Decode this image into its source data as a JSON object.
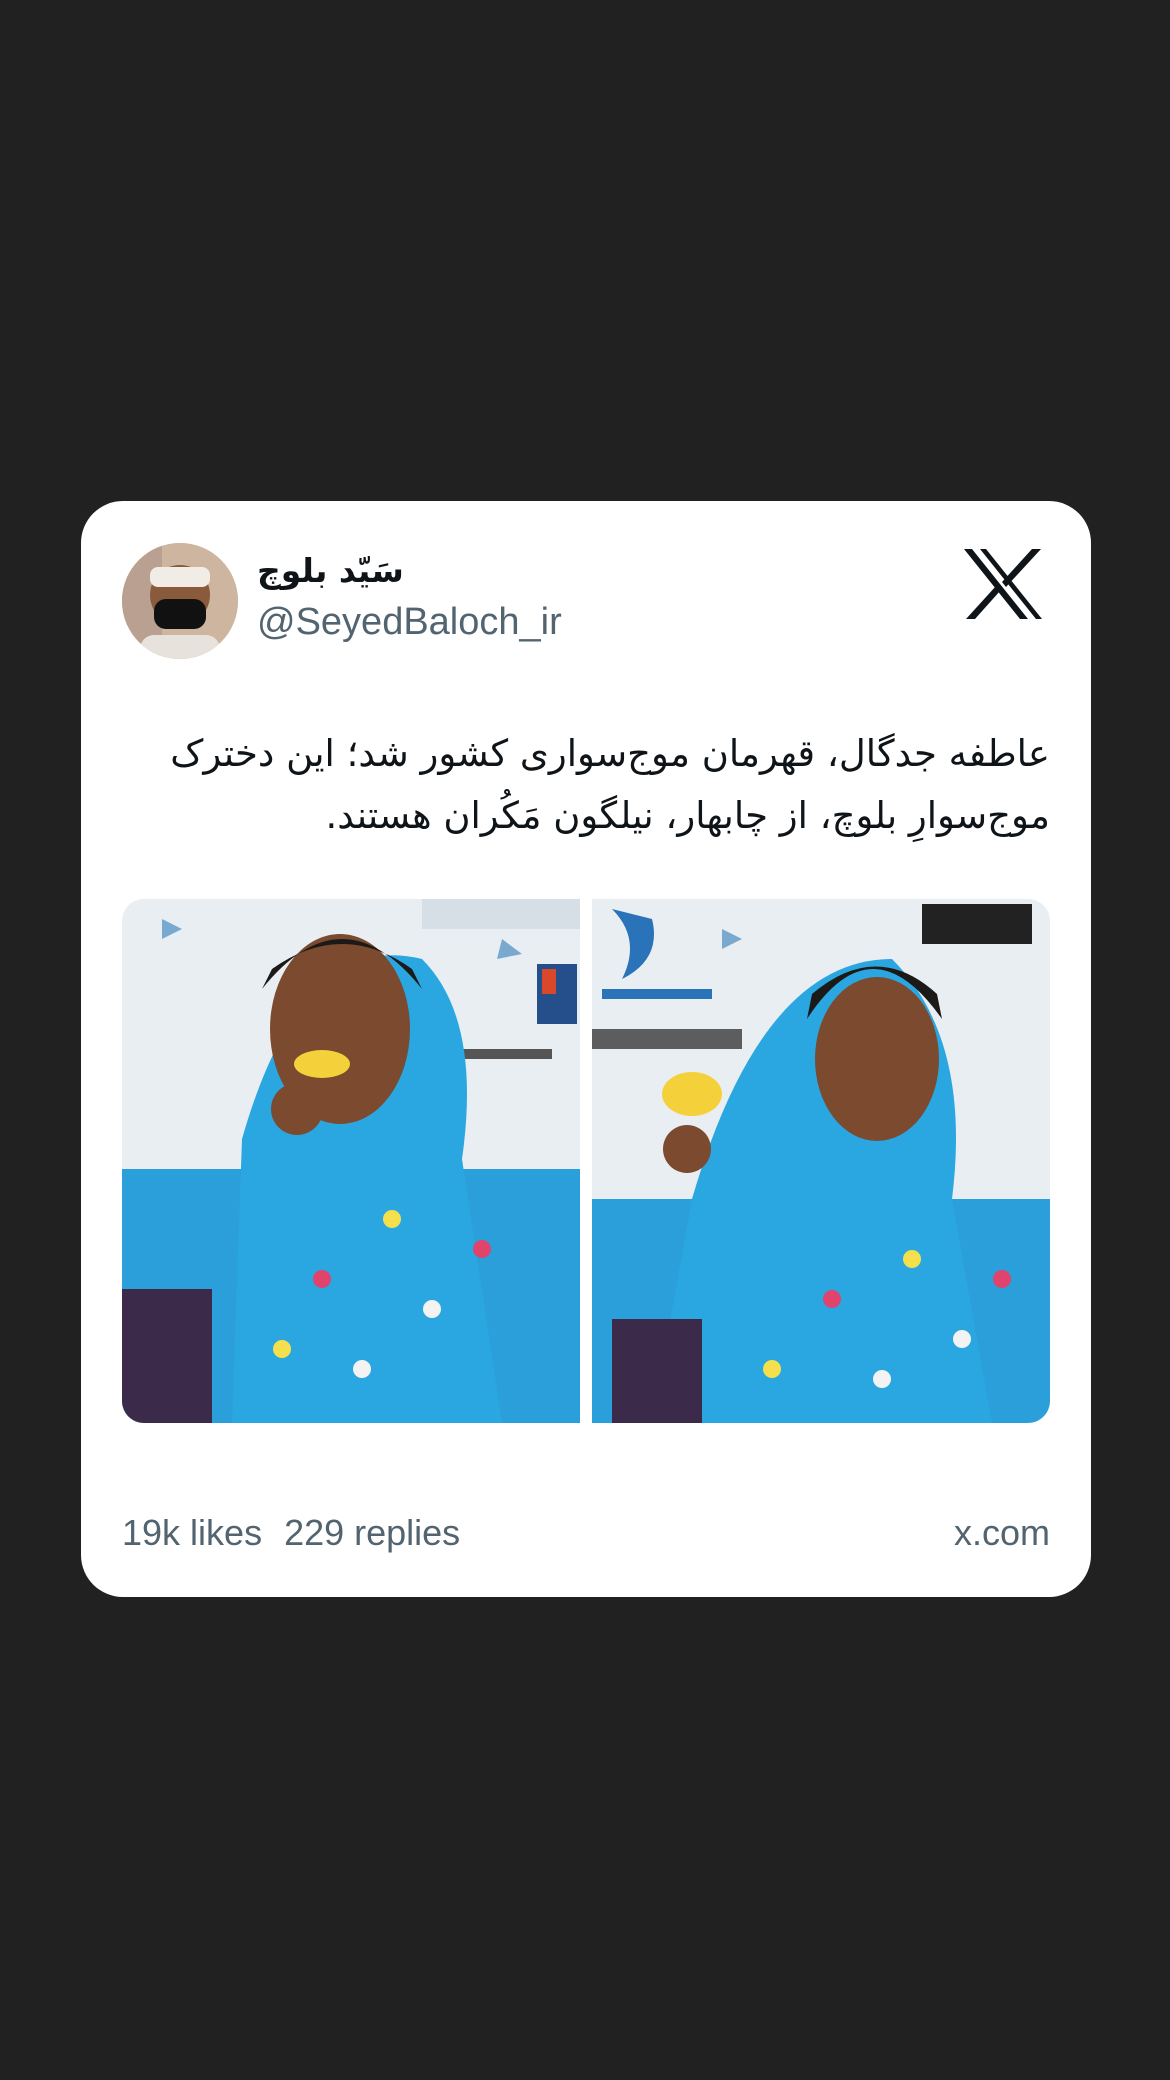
{
  "tweet": {
    "display_name": "سَیّد بلوچ",
    "handle": "@SeyedBaloch_ir",
    "text": "عاطفه جدگال، قهرمان موج‌سواری کشور شد؛ این دخترک موج‌سوارِ بلوچ، از چابهار، نیلگون مَکُران هستند.",
    "platform_icon": "x-logo-icon",
    "photos": [
      {
        "name": "photo-left",
        "description_icon": "medal-photo"
      },
      {
        "name": "photo-right",
        "description_icon": "medal-photo"
      }
    ],
    "likes": "19k likes",
    "replies": "229 replies",
    "domain": "x.com"
  },
  "colors": {
    "background": "#212121",
    "card": "#ffffff",
    "text_primary": "#0f1419",
    "text_secondary": "#536471",
    "dress_blue": "#2aa7e0"
  }
}
